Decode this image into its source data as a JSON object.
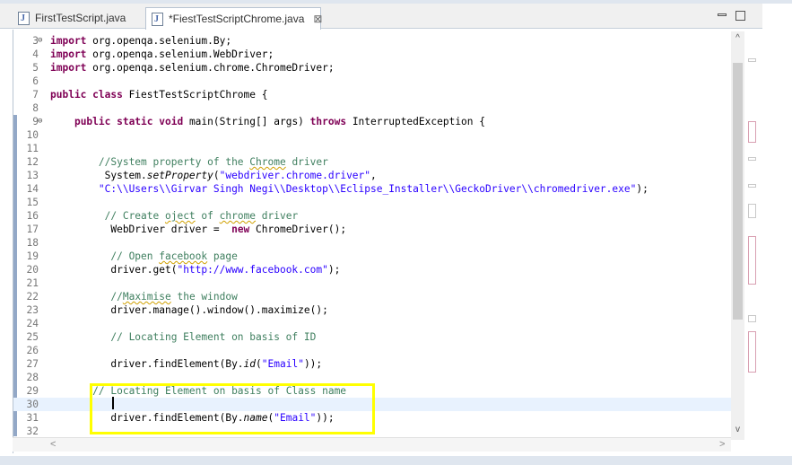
{
  "tabs": [
    {
      "label": "FirstTestScript.java",
      "active": false,
      "icon": "java-file-icon"
    },
    {
      "label": "*FiestTestScriptChrome.java",
      "active": true,
      "icon": "java-file-icon",
      "close": "⊠"
    }
  ],
  "window_controls": {
    "minimize": "minimize-icon",
    "maximize": "maximize-icon"
  },
  "colors": {
    "keyword": "#7f0055",
    "string": "#2a00ff",
    "comment": "#3f7f5f",
    "highlight_box": "#ffff00",
    "current_line": "#e8f2fe"
  },
  "lines": [
    {
      "n": "3",
      "fold": "⊖",
      "html": "<span class='kw'>import</span> org.openqa.selenium.By;"
    },
    {
      "n": "4",
      "html": "<span class='kw'>import</span> org.openqa.selenium.WebDriver;"
    },
    {
      "n": "5",
      "html": "<span class='kw'>import</span> org.openqa.selenium.chrome.ChromeDriver;"
    },
    {
      "n": "6",
      "html": ""
    },
    {
      "n": "7",
      "html": "<span class='kw'>public class</span> FiestTestScriptChrome {"
    },
    {
      "n": "8",
      "html": ""
    },
    {
      "n": "9",
      "fold": "⊖",
      "html": "    <span class='kw'>public static void</span> main(String[] args) <span class='kw'>throws</span> InterruptedException {"
    },
    {
      "n": "10",
      "html": ""
    },
    {
      "n": "11",
      "html": ""
    },
    {
      "n": "12",
      "html": "        <span class='cm'>//System property of the <span class='sq'>Chrome</span> driver</span>"
    },
    {
      "n": "13",
      "html": "         System.<span class='it'>setProperty</span>(<span class='str'>\"webdriver.chrome.driver\"</span>,"
    },
    {
      "n": "14",
      "html": "        <span class='str'>\"C:\\\\Users\\\\Girvar Singh Negi\\\\Desktop\\\\Eclipse_Installer\\\\GeckoDriver\\\\chromedriver.exe\"</span>);"
    },
    {
      "n": "15",
      "html": ""
    },
    {
      "n": "16",
      "html": "         <span class='cm'>// Create <span class='sq'>oject</span> of <span class='sq'>chrome</span> driver</span>"
    },
    {
      "n": "17",
      "html": "          WebDriver driver =  <span class='kw'>new</span> ChromeDriver();"
    },
    {
      "n": "18",
      "html": ""
    },
    {
      "n": "19",
      "html": "          <span class='cm'>// Open <span class='sq'>facebook</span> page</span>"
    },
    {
      "n": "20",
      "html": "          driver.get(<span class='str'>\"http://www.facebook.com\"</span>);"
    },
    {
      "n": "21",
      "html": ""
    },
    {
      "n": "22",
      "html": "          <span class='cm'>//<span class='sq'>Maximise</span> the window</span>"
    },
    {
      "n": "23",
      "html": "          driver.manage().window().maximize();"
    },
    {
      "n": "24",
      "html": ""
    },
    {
      "n": "25",
      "html": "          <span class='cm'>// Locating Element on basis of ID</span>"
    },
    {
      "n": "26",
      "html": ""
    },
    {
      "n": "27",
      "html": "          driver.findElement(By.<span class='it'>id</span>(<span class='str'>\"Email\"</span>));"
    },
    {
      "n": "28",
      "html": ""
    },
    {
      "n": "29",
      "html": "       <span class='cm'>// Locating Element on basis of Class name</span>"
    },
    {
      "n": "30",
      "html": "",
      "current": true
    },
    {
      "n": "31",
      "html": "          driver.findElement(By.<span class='it'>name</span>(<span class='str'>\"Email\"</span>));"
    },
    {
      "n": "32",
      "html": ""
    }
  ],
  "scroll": {
    "up": "^",
    "down": "v",
    "left": "<",
    "right": ">"
  }
}
